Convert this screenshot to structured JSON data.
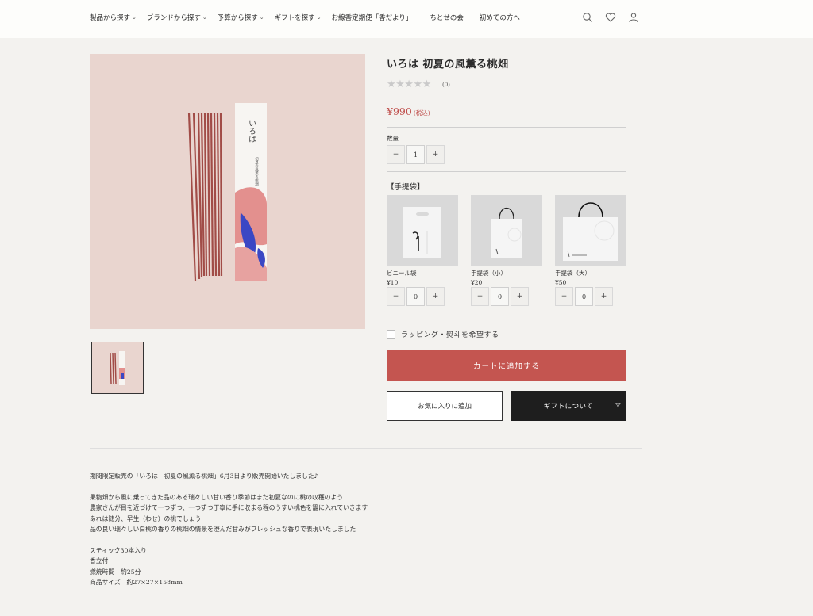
{
  "nav": {
    "items": [
      {
        "label": "製品から探す",
        "dropdown": true
      },
      {
        "label": "ブランドから探す",
        "dropdown": true
      },
      {
        "label": "予算から探す",
        "dropdown": true
      },
      {
        "label": "ギフトを探す",
        "dropdown": true
      },
      {
        "label": "お線香定期便「香だより」",
        "dropdown": false
      },
      {
        "label": "ちとせの会",
        "dropdown": false
      },
      {
        "label": "初めての方へ",
        "dropdown": false
      }
    ],
    "icons": [
      "search-icon",
      "heart-icon",
      "user-icon"
    ]
  },
  "product": {
    "title": "いろは 初夏の風薫る桃畑",
    "stars": "★★★★★",
    "rating_count": "(0)",
    "price": "¥990",
    "tax_note": "(税込)",
    "qty_label": "数量",
    "qty_value": "1",
    "box_text": "いろは",
    "box_subtext": "初夏の風薫る桃畑"
  },
  "bags": {
    "heading": "【手提袋】",
    "items": [
      {
        "name": "ビニール袋",
        "price": "¥10",
        "qty": "0"
      },
      {
        "name": "手提袋（小）",
        "price": "¥20",
        "qty": "0"
      },
      {
        "name": "手提袋（大）",
        "price": "¥50",
        "qty": "0"
      }
    ]
  },
  "stepper": {
    "minus": "−",
    "plus": "+"
  },
  "wrapping_label": "ラッピング・熨斗を希望する",
  "buttons": {
    "cart": "カートに追加する",
    "favorite": "お気に入りに追加",
    "gift": "ギフトについて",
    "gift_icon": "▽"
  },
  "description": {
    "lines_1": [
      "期間限定販売の「いろは　初夏の風薫る桃畑」6月3日より販売開始いたしました♪"
    ],
    "lines_2": [
      "果物畑から風に乗ってきた品のある瑞々しい甘い香り季節はまだ初夏なのに桃の収穫のよう",
      "農家さんが目を近づけて一つずつ、一つずつ丁寧に手に収まる程のうすい桃色を籠に入れていきます",
      "あれは随分、早生（わせ）の桃でしょう",
      "品の良い瑞々しい白桃の香りの桃畑の情景を澄んだ甘みがフレッシュな香りで表現いたしました"
    ],
    "lines_3": [
      "スティック30本入り",
      "香立付",
      "燃焼時間　約25分",
      "商品サイズ　約27×27×158mm"
    ]
  },
  "colors": {
    "accent": "#c45550",
    "price": "#c0504d",
    "dark_button": "#1e1e1e",
    "image_bg": "#e8d3cd"
  }
}
